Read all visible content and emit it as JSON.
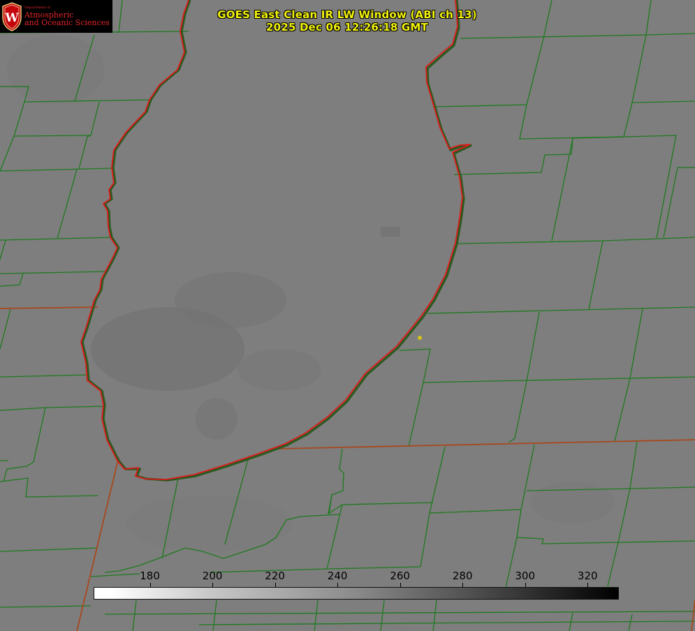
{
  "title": {
    "line1": "GOES East Clean IR LW Window (ABI ch 13)",
    "line2": "2025 Dec 06 12:26:18 GMT"
  },
  "logo": {
    "dept": "Department of",
    "line1": "Atmospheric",
    "line2": "and Oceanic Sciences",
    "crest_letter": "W"
  },
  "colorbar": {
    "min": 162,
    "max": 330,
    "tick_labels": [
      "180",
      "200",
      "220",
      "240",
      "260",
      "280",
      "300",
      "320"
    ],
    "tick_values": [
      180,
      200,
      220,
      240,
      260,
      280,
      300,
      320
    ],
    "color_low": "#ffffff",
    "color_high": "#000000"
  },
  "colors": {
    "title": "#f2f20a",
    "county_lines": "#1e7a1e",
    "lake_outline": "#e01818",
    "state_line": "#b04020",
    "marker": "#d4c41a",
    "background": "#7d7d7d"
  },
  "marker": {
    "name": "location-dot"
  }
}
